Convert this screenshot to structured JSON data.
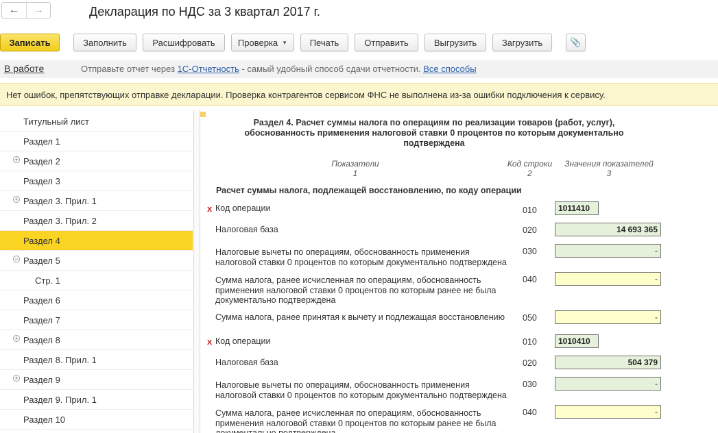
{
  "window": {
    "title": "Декларация по НДС за 3 квартал 2017 г.",
    "back_icon": "←",
    "forward_icon": "→"
  },
  "toolbar": {
    "write": "Записать",
    "fill": "Заполнить",
    "decode": "Расшифровать",
    "check": "Проверка",
    "print": "Печать",
    "send": "Отправить",
    "upload": "Выгрузить",
    "download": "Загрузить",
    "attach_icon": "📎"
  },
  "status": {
    "state": "В работе",
    "prefix": "Отправьте отчет через ",
    "service_link": "1С-Отчетность",
    "middle": " - самый удобный способ сдачи отчетности. ",
    "all_ways_link": "Все способы"
  },
  "info_message": "Нет ошибок, препятствующих отправке декларации. Проверка контрагентов сервисом ФНС не выполнена из-за ошибки подключения к сервису.",
  "sidebar": {
    "items": [
      {
        "label": "Титульный лист",
        "expander": ""
      },
      {
        "label": "Раздел 1",
        "expander": ""
      },
      {
        "label": "Раздел 2",
        "expander": "+"
      },
      {
        "label": "Раздел 3",
        "expander": ""
      },
      {
        "label": "Раздел 3. Прил. 1",
        "expander": "+"
      },
      {
        "label": "Раздел 3. Прил. 2",
        "expander": ""
      },
      {
        "label": "Раздел 4",
        "expander": "",
        "active": true
      },
      {
        "label": "Раздел 5",
        "expander": "−"
      },
      {
        "label": "Стр. 1",
        "expander": "",
        "indent": true
      },
      {
        "label": "Раздел 6",
        "expander": ""
      },
      {
        "label": "Раздел 7",
        "expander": ""
      },
      {
        "label": "Раздел 8",
        "expander": "+"
      },
      {
        "label": "Раздел 8. Прил. 1",
        "expander": ""
      },
      {
        "label": "Раздел 9",
        "expander": "+"
      },
      {
        "label": "Раздел 9. Прил. 1",
        "expander": ""
      },
      {
        "label": "Раздел 10",
        "expander": ""
      }
    ]
  },
  "section": {
    "title": "Раздел 4. Расчет суммы налога по операциям по реализации товаров (работ, услуг), обоснованность применения налоговой ставки 0 процентов по которым документально подтверждена",
    "col_indicators": "Показатели",
    "col_indicators_num": "1",
    "col_code": "Код строки",
    "col_code_num": "2",
    "col_values": "Значения показателей",
    "col_values_num": "3",
    "subheading": "Расчет суммы налога, подлежащей восстановлению, по коду операции",
    "required_mark": "x",
    "rows": [
      {
        "label": "Код операции",
        "code": "010",
        "value": "1011410"
      },
      {
        "label": "Налоговая база",
        "code": "020",
        "value": "14 693 365"
      },
      {
        "label": "Налоговые вычеты по операциям, обоснованность применения налоговой ставки 0 процентов по которым документально подтверждена",
        "code": "030",
        "value": "-"
      },
      {
        "label": "Сумма налога, ранее исчисленная по операциям, обоснованность применения налоговой ставки 0 процентов по которым ранее не была документально подтверждена",
        "code": "040",
        "value": "-"
      },
      {
        "label": "Сумма налога, ранее принятая к вычету и подлежащая восстановлению",
        "code": "050",
        "value": "-"
      },
      {
        "label": "Код операции",
        "code": "010",
        "value": "1010410"
      },
      {
        "label": "Налоговая база",
        "code": "020",
        "value": "504 379"
      },
      {
        "label": "Налоговые вычеты по операциям, обоснованность применения налоговой ставки 0 процентов по которым документально подтверждена",
        "code": "030",
        "value": "-"
      },
      {
        "label": "Сумма налога, ранее исчисленная по операциям, обоснованность применения налоговой ставки 0 процентов по которым ранее не была документально подтверждена",
        "code": "040",
        "value": "-"
      }
    ]
  },
  "colors": {
    "accent": "#f9d423",
    "info_bg": "#fbf6cd",
    "field_green": "#e6f1dc",
    "field_yellow": "#ffffcc",
    "required": "#c62828"
  }
}
